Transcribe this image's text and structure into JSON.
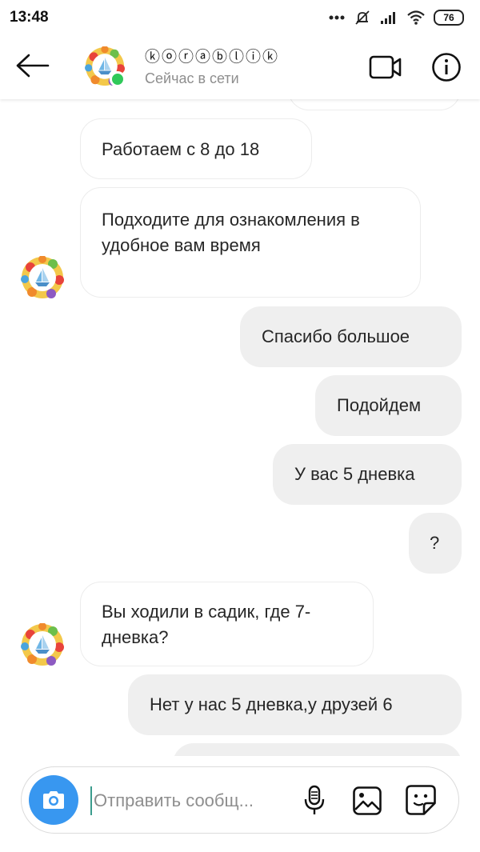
{
  "status_bar": {
    "time": "13:48",
    "battery": "76"
  },
  "header": {
    "name": "ⓚⓞⓡⓐⓑⓛⓘⓚ",
    "status": "Сейчас в сети"
  },
  "messages": [
    {
      "direction": "in",
      "text": "Работаем с 8 до 18"
    },
    {
      "direction": "in",
      "text": "Подходите для ознакомления в удобное вам время"
    },
    {
      "direction": "out",
      "text": "Спасибо большое"
    },
    {
      "direction": "out",
      "text": "Подойдем"
    },
    {
      "direction": "out",
      "text": "У вас 5 дневка"
    },
    {
      "direction": "out",
      "text": "?"
    },
    {
      "direction": "in",
      "text": "Вы ходили в садик, где 7-дневка?"
    },
    {
      "direction": "out",
      "text": "Нет у нас 5 дневка,у друзей 6"
    }
  ],
  "composer": {
    "placeholder": "Отправить сообщ..."
  },
  "colors": {
    "accent": "#3897f0",
    "online": "#30c95a",
    "outgoing_bubble": "#efefef"
  },
  "icons": [
    "back-arrow-icon",
    "video-call-icon",
    "info-icon",
    "camera-icon",
    "microphone-icon",
    "gallery-icon",
    "sticker-icon"
  ]
}
